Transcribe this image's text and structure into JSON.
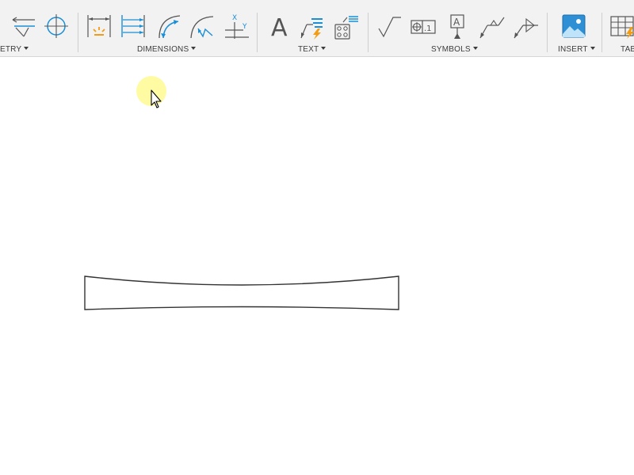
{
  "ribbon": {
    "groups": [
      {
        "label": "ETRY"
      },
      {
        "label": "DIMENSIONS"
      },
      {
        "label": "TEXT"
      },
      {
        "label": "SYMBOLS"
      },
      {
        "label": "INSERT"
      },
      {
        "label": "TAB"
      }
    ]
  },
  "colors": {
    "accent_blue": "#1b8fd6",
    "accent_orange": "#f39c12",
    "icon_gray": "#555555",
    "cursor_highlight": "#fffb99"
  },
  "icons": [
    "center-mark-line-icon",
    "centerline-crosshair-icon",
    "linear-dimension-icon",
    "baseline-dimension-icon",
    "arc-length-dimension-icon",
    "radial-dimension-icon",
    "ordinate-dimension-icon",
    "text-icon",
    "leader-text-icon",
    "hole-note-icon",
    "surface-texture-icon",
    "feature-control-frame-icon",
    "datum-identifier-icon",
    "welding-symbol-icon",
    "edge-symbol-icon",
    "image-icon",
    "table-icon"
  ]
}
